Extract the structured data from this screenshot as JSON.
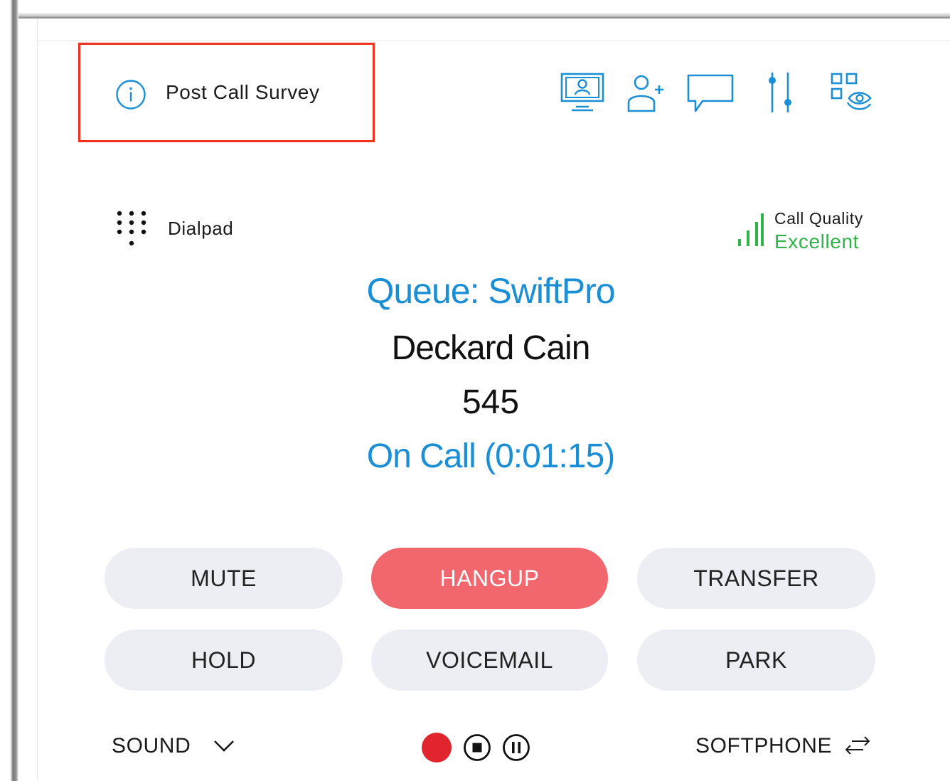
{
  "header": {
    "survey_label": "Post Call Survey",
    "icons": [
      "screen-share-icon",
      "add-contact-icon",
      "chat-icon",
      "settings-sliders-icon",
      "qr-scan-icon"
    ]
  },
  "dialpad": {
    "label": "Dialpad"
  },
  "call_quality": {
    "title": "Call Quality",
    "value": "Excellent",
    "color": "#2fb54a"
  },
  "call": {
    "queue": "Queue: SwiftPro",
    "caller_name": "Deckard Cain",
    "extension": "545",
    "status": "On Call (0:01:15)"
  },
  "controls": {
    "mute": "MUTE",
    "hangup": "HANGUP",
    "transfer": "TRANSFER",
    "hold": "HOLD",
    "voicemail": "VOICEMAIL",
    "park": "PARK"
  },
  "footer": {
    "sound": "SOUND",
    "softphone": "SOFTPHONE"
  },
  "colors": {
    "accent": "#1a8fd6",
    "hangup": "#f2666e",
    "record": "#e0252f",
    "highlight_box": "#f2321e"
  }
}
